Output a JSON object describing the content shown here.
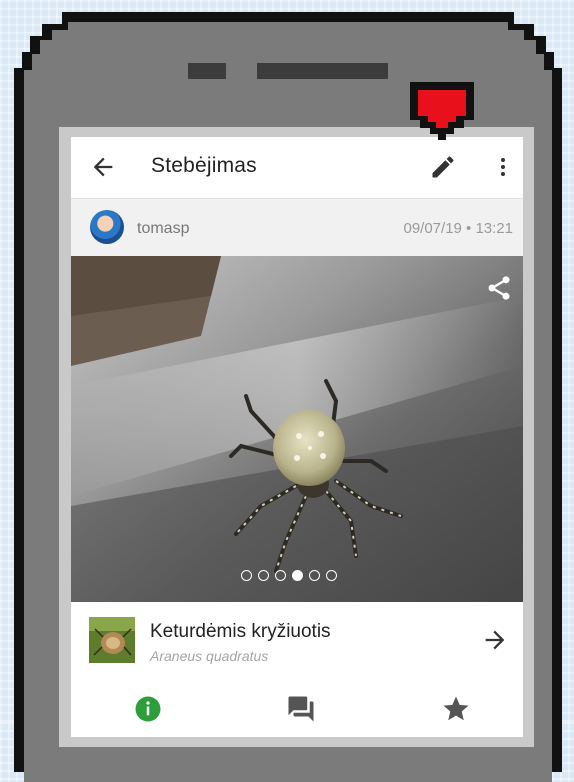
{
  "header": {
    "title": "Stebėjimas",
    "back_icon": "arrow-left-icon",
    "edit_icon": "pencil-icon",
    "more_icon": "more-vertical-icon"
  },
  "observation": {
    "username": "tomasp",
    "timestamp": "09/07/19 • 13:21",
    "photo_count": 6,
    "active_photo_index": 3,
    "share_icon": "share-icon"
  },
  "species": {
    "common_name": "Keturdėmis kryžiuotis",
    "scientific_name": "Araneus quadratus",
    "arrow_icon": "arrow-right-icon"
  },
  "tabs": [
    {
      "icon": "info-icon",
      "color": "#2e9e3a"
    },
    {
      "icon": "comments-icon",
      "color": "#555555"
    },
    {
      "icon": "star-icon",
      "color": "#555555"
    }
  ],
  "colors": {
    "marker": "#e8101a",
    "phone_frame": "#7b7b7b",
    "active_tab": "#2e9e3a"
  }
}
